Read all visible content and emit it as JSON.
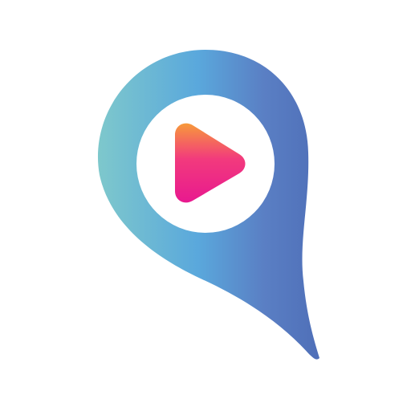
{
  "logo": {
    "icon": "play-location-pin-icon",
    "pin_gradient": [
      "#7ec8cc",
      "#5aa8dc",
      "#5a7fc4",
      "#4f6fb8"
    ],
    "play_gradient": [
      "#f79a3a",
      "#f23a7d",
      "#e8198f"
    ],
    "inner_circle_color": "#ffffff",
    "background_color": "#ffffff"
  }
}
